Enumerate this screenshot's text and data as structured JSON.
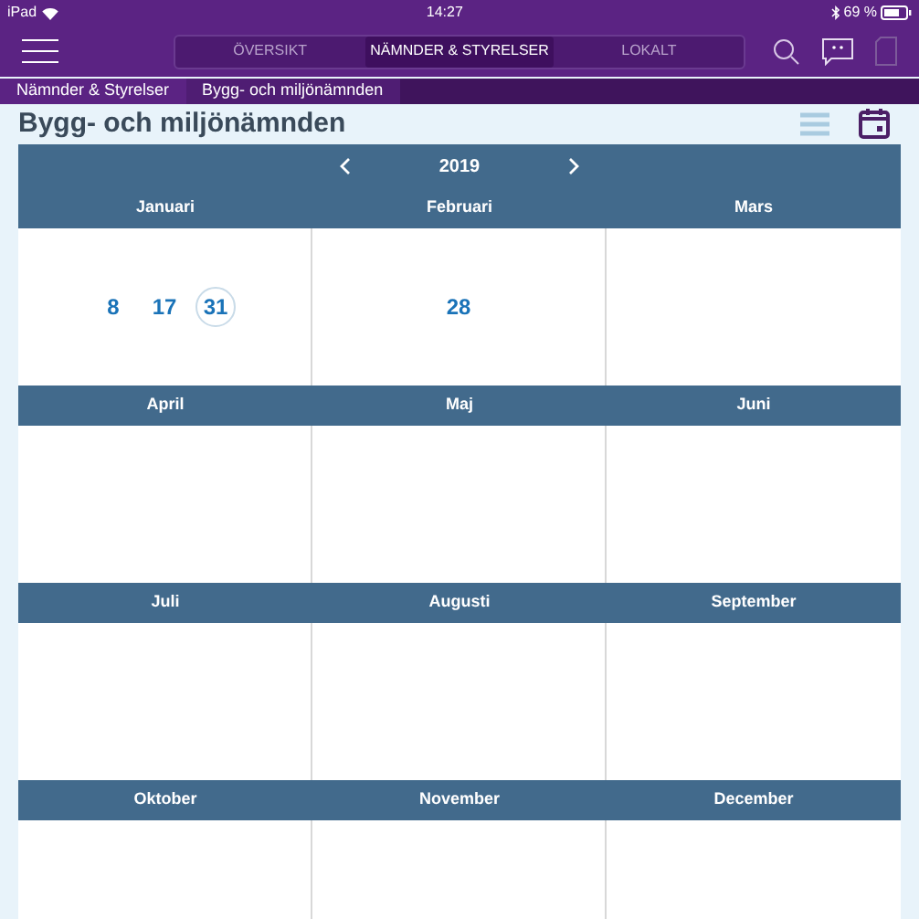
{
  "status_bar": {
    "device": "iPad",
    "time": "14:27",
    "battery": "69 %"
  },
  "tabs": [
    {
      "label": "ÖVERSIKT",
      "selected": false
    },
    {
      "label": "NÄMNDER & STYRELSER",
      "selected": true
    },
    {
      "label": "LOKALT",
      "selected": false
    }
  ],
  "breadcrumbs": [
    {
      "label": "Nämnder & Styrelser",
      "selected": false
    },
    {
      "label": "Bygg- och miljönämnden",
      "selected": true
    }
  ],
  "page_title": "Bygg- och miljönämnden",
  "view_toggle": [
    {
      "kind": "list",
      "selected": false
    },
    {
      "kind": "calendar",
      "selected": true
    }
  ],
  "calendar": {
    "year": "2019",
    "months": [
      {
        "name": "Januari",
        "dates": [
          {
            "day": "8",
            "selected": false
          },
          {
            "day": "17",
            "selected": false
          },
          {
            "day": "31",
            "selected": true
          }
        ]
      },
      {
        "name": "Februari",
        "dates": [
          {
            "day": "28",
            "selected": false
          }
        ]
      },
      {
        "name": "Mars"
      },
      {
        "name": "April"
      },
      {
        "name": "Maj"
      },
      {
        "name": "Juni"
      },
      {
        "name": "Juli"
      },
      {
        "name": "Augusti"
      },
      {
        "name": "September"
      },
      {
        "name": "Oktober"
      },
      {
        "name": "November"
      },
      {
        "name": "December"
      }
    ]
  }
}
